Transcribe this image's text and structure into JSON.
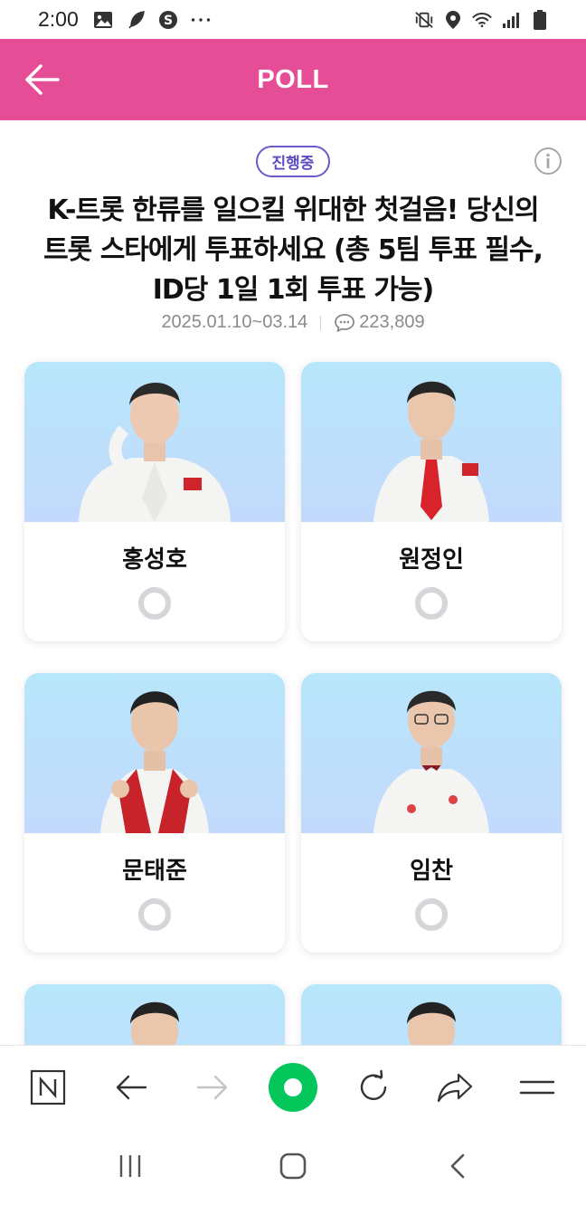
{
  "status_bar": {
    "time": "2:00",
    "left_icons": [
      "image-icon",
      "feather-icon",
      "s-badge-icon",
      "more-dots-icon"
    ],
    "right_icons": [
      "vibrate-off-icon",
      "location-icon",
      "wifi-icon",
      "signal-icon",
      "battery-icon"
    ],
    "more": "···"
  },
  "header": {
    "title": "POLL",
    "back_icon": "back-arrow-icon",
    "background": "#e54e96"
  },
  "poll": {
    "status": "진행중",
    "status_color": "#5b4bc4",
    "title": "K-트롯 한류를 일으킬 위대한 첫걸음! 당신의 트롯 스타에게 투표하세요 (총 5팀 투표 필수, ID당 1일 1회 투표 가능)",
    "period": "2025.01.10~03.14",
    "comment_count": "223,809"
  },
  "candidates": [
    {
      "name": "홍성호",
      "selected": false
    },
    {
      "name": "원정인",
      "selected": false
    },
    {
      "name": "문태준",
      "selected": false
    },
    {
      "name": "임찬",
      "selected": false
    },
    {
      "name": "",
      "selected": false
    },
    {
      "name": "",
      "selected": false
    }
  ],
  "browser_bar": {
    "icons": [
      "naver-n-icon",
      "back-icon",
      "forward-icon",
      "home-green-icon",
      "refresh-icon",
      "share-icon",
      "menu-icon"
    ],
    "accent": "#03c75a"
  },
  "nav_bar": {
    "icons": [
      "recent-apps-icon",
      "home-icon",
      "back-icon"
    ]
  }
}
